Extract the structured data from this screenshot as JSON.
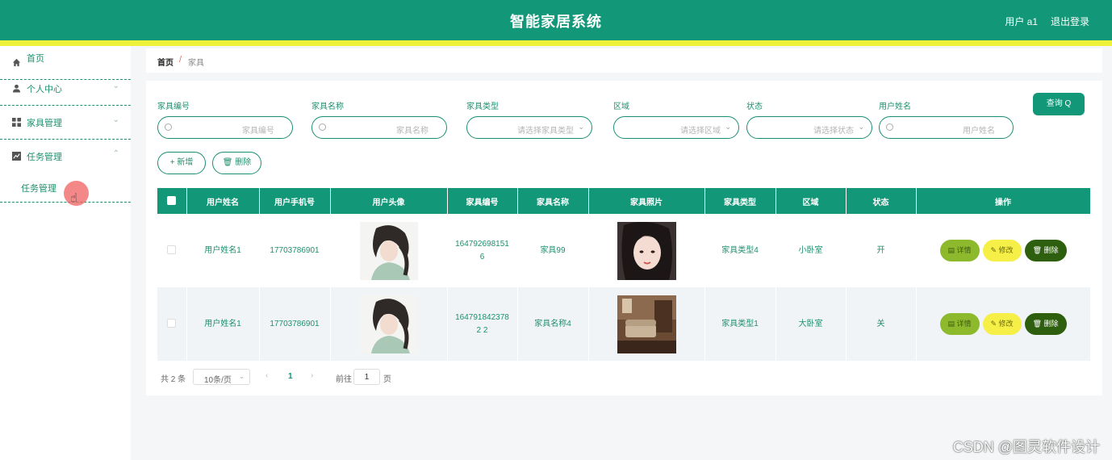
{
  "header": {
    "title": "智能家居系统",
    "user": "用户 a1",
    "logout": "退出登录"
  },
  "sidebar": {
    "items": [
      {
        "label": "首页",
        "icon": "home-icon"
      },
      {
        "label": "个人中心",
        "icon": "user-icon",
        "chevron": "⌄"
      },
      {
        "label": "家具管理",
        "icon": "grid-icon",
        "chevron": "⌄"
      },
      {
        "label": "任务管理",
        "icon": "chart-icon",
        "chevron": "⌃"
      }
    ],
    "submenu": {
      "label": "任务管理"
    }
  },
  "breadcrumb": {
    "home": "首页",
    "sep": "/",
    "current": "家具"
  },
  "filters": {
    "fields": [
      {
        "label": "家具编号",
        "placeholder": "家具编号"
      },
      {
        "label": "家具名称",
        "placeholder": "家具名称"
      },
      {
        "label": "家具类型",
        "placeholder": "请选择家具类型"
      },
      {
        "label": "区域",
        "placeholder": "请选择区域"
      },
      {
        "label": "状态",
        "placeholder": "请选择状态"
      },
      {
        "label": "用户姓名",
        "placeholder": "用户姓名"
      }
    ],
    "query_label": "查询 Q"
  },
  "actions": {
    "add_label": "+ 新增",
    "delete_label": "🗑 删除"
  },
  "table": {
    "headers": [
      "",
      "用户姓名",
      "用户手机号",
      "用户头像",
      "家具编号",
      "家具名称",
      "家具照片",
      "家具类型",
      "区域",
      "状态",
      "操作"
    ],
    "rows": [
      {
        "name": "用户姓名1",
        "phone": "17703786901",
        "code": "1647926981516",
        "fname": "家具99",
        "ftype": "家具类型4",
        "area": "小卧室",
        "status": "开"
      },
      {
        "name": "用户姓名1",
        "phone": "17703786901",
        "code": "1647918423782 2",
        "fname": "家具名称4",
        "ftype": "家具类型1",
        "area": "大卧室",
        "status": "关"
      }
    ],
    "ops": {
      "detail": "▤ 详情",
      "edit": "✎ 修改",
      "delete": "🗑 删除"
    }
  },
  "pager": {
    "total": "共 2 条",
    "size": "10条/页",
    "page": "1",
    "goto": "前往",
    "goto_value": "1",
    "unit": "页"
  },
  "watermark": "CSDN @图灵软件设计",
  "colors": {
    "primary": "#129878",
    "stripe": "#eef23a",
    "detail": "#8db92d",
    "edit": "#f5ef47",
    "del": "#2e5f0f"
  }
}
